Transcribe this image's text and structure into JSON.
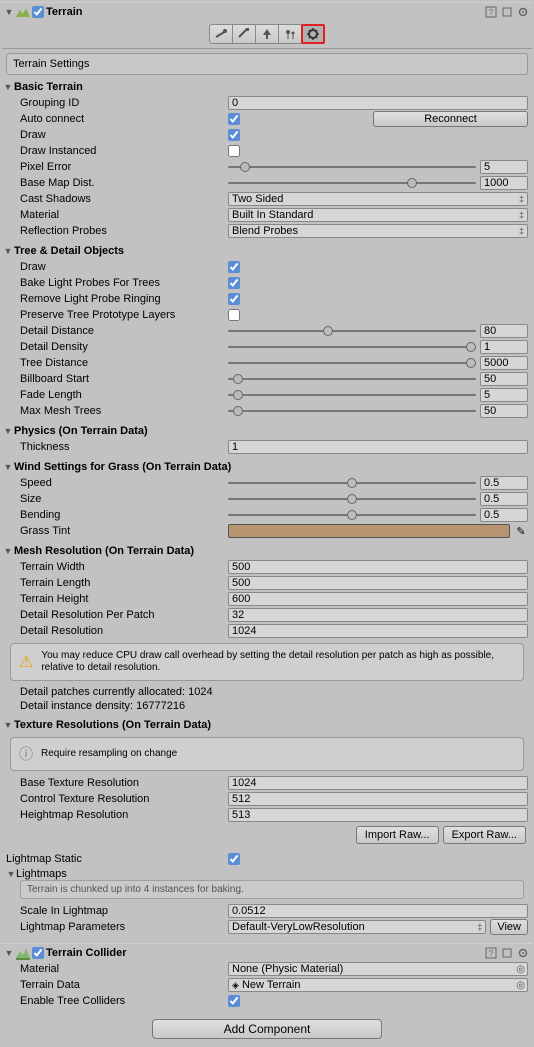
{
  "terrain": {
    "title": "Terrain",
    "toolbar_selected": 4
  },
  "settings_label": "Terrain Settings",
  "basic": {
    "header": "Basic Terrain",
    "grouping_id": {
      "label": "Grouping ID",
      "value": "0"
    },
    "auto_connect": {
      "label": "Auto connect",
      "value": true,
      "reconnect": "Reconnect"
    },
    "draw": {
      "label": "Draw",
      "value": true
    },
    "draw_instanced": {
      "label": "Draw Instanced",
      "value": false
    },
    "pixel_error": {
      "label": "Pixel Error",
      "value": "5",
      "slider": 5,
      "min": 0,
      "max": 100
    },
    "base_map_dist": {
      "label": "Base Map Dist.",
      "value": "1000",
      "slider": 75,
      "min": 0,
      "max": 100
    },
    "cast_shadows": {
      "label": "Cast Shadows",
      "value": "Two Sided"
    },
    "material": {
      "label": "Material",
      "value": "Built In Standard"
    },
    "reflection_probes": {
      "label": "Reflection Probes",
      "value": "Blend Probes"
    }
  },
  "tree": {
    "header": "Tree & Detail Objects",
    "draw": {
      "label": "Draw",
      "value": true
    },
    "bake_light": {
      "label": "Bake Light Probes For Trees",
      "value": true
    },
    "remove_ringing": {
      "label": "Remove Light Probe Ringing",
      "value": true
    },
    "preserve_proto": {
      "label": "Preserve Tree Prototype Layers",
      "value": false
    },
    "detail_distance": {
      "label": "Detail Distance",
      "value": "80",
      "slider": 40,
      "min": 0,
      "max": 100
    },
    "detail_density": {
      "label": "Detail Density",
      "value": "1",
      "slider": 100,
      "min": 0,
      "max": 100
    },
    "tree_distance": {
      "label": "Tree Distance",
      "value": "5000",
      "slider": 100,
      "min": 0,
      "max": 100
    },
    "billboard_start": {
      "label": "Billboard Start",
      "value": "50",
      "slider": 2,
      "min": 0,
      "max": 100
    },
    "fade_length": {
      "label": "Fade Length",
      "value": "5",
      "slider": 2,
      "min": 0,
      "max": 100
    },
    "max_mesh_trees": {
      "label": "Max Mesh Trees",
      "value": "50",
      "slider": 2,
      "min": 0,
      "max": 100
    }
  },
  "physics": {
    "header": "Physics (On Terrain Data)",
    "thickness": {
      "label": "Thickness",
      "value": "1"
    }
  },
  "wind": {
    "header": "Wind Settings for Grass (On Terrain Data)",
    "speed": {
      "label": "Speed",
      "value": "0.5",
      "slider": 50,
      "min": 0,
      "max": 100
    },
    "size": {
      "label": "Size",
      "value": "0.5",
      "slider": 50,
      "min": 0,
      "max": 100
    },
    "bending": {
      "label": "Bending",
      "value": "0.5",
      "slider": 50,
      "min": 0,
      "max": 100
    },
    "grass_tint": {
      "label": "Grass Tint",
      "color": "#b89470"
    }
  },
  "mesh": {
    "header": "Mesh Resolution (On Terrain Data)",
    "width": {
      "label": "Terrain Width",
      "value": "500"
    },
    "length": {
      "label": "Terrain Length",
      "value": "500"
    },
    "height": {
      "label": "Terrain Height",
      "value": "600"
    },
    "detail_res_patch": {
      "label": "Detail Resolution Per Patch",
      "value": "32"
    },
    "detail_res": {
      "label": "Detail Resolution",
      "value": "1024"
    },
    "warning": "You may reduce CPU draw call overhead by setting the detail resolution per patch as high as possible, relative to detail resolution.",
    "patches": "Detail patches currently allocated: 1024",
    "density": "Detail instance density: 16777216"
  },
  "texres": {
    "header": "Texture Resolutions (On Terrain Data)",
    "hint": "Require resampling on change",
    "base": {
      "label": "Base Texture Resolution",
      "value": "1024"
    },
    "control": {
      "label": "Control Texture Resolution",
      "value": "512"
    },
    "heightmap": {
      "label": "Heightmap Resolution",
      "value": "513"
    },
    "import_btn": "Import Raw...",
    "export_btn": "Export Raw..."
  },
  "lightmap": {
    "static": {
      "label": "Lightmap Static",
      "value": true
    },
    "header": "Lightmaps",
    "chunk_hint": "Terrain is chunked up into 4 instances for baking.",
    "scale": {
      "label": "Scale In Lightmap",
      "value": "0.0512"
    },
    "params": {
      "label": "Lightmap Parameters",
      "value": "Default-VeryLowResolution",
      "view": "View"
    }
  },
  "collider": {
    "title": "Terrain Collider",
    "material": {
      "label": "Material",
      "value": "None (Physic Material)"
    },
    "terrain_data": {
      "label": "Terrain Data",
      "value": "New Terrain"
    },
    "enable_tree": {
      "label": "Enable Tree Colliders",
      "value": true
    }
  },
  "add_component": "Add Component"
}
